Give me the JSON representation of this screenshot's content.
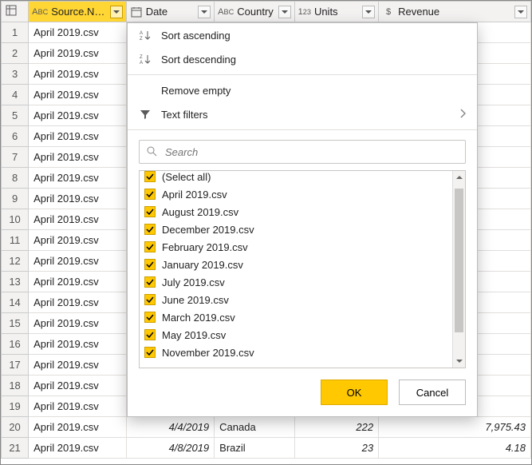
{
  "columns": [
    {
      "key": "source",
      "label": "Source.Name",
      "type_icon": "abc",
      "selected": true
    },
    {
      "key": "date",
      "label": "Date",
      "type_icon": "date"
    },
    {
      "key": "country",
      "label": "Country",
      "type_icon": "abc"
    },
    {
      "key": "units",
      "label": "Units",
      "type_icon": "123"
    },
    {
      "key": "revenue",
      "label": "Revenue",
      "type_icon": "dollar"
    }
  ],
  "rows": [
    {
      "n": 1,
      "source": "April 2019.csv"
    },
    {
      "n": 2,
      "source": "April 2019.csv"
    },
    {
      "n": 3,
      "source": "April 2019.csv"
    },
    {
      "n": 4,
      "source": "April 2019.csv"
    },
    {
      "n": 5,
      "source": "April 2019.csv"
    },
    {
      "n": 6,
      "source": "April 2019.csv"
    },
    {
      "n": 7,
      "source": "April 2019.csv"
    },
    {
      "n": 8,
      "source": "April 2019.csv"
    },
    {
      "n": 9,
      "source": "April 2019.csv"
    },
    {
      "n": 10,
      "source": "April 2019.csv"
    },
    {
      "n": 11,
      "source": "April 2019.csv"
    },
    {
      "n": 12,
      "source": "April 2019.csv"
    },
    {
      "n": 13,
      "source": "April 2019.csv"
    },
    {
      "n": 14,
      "source": "April 2019.csv"
    },
    {
      "n": 15,
      "source": "April 2019.csv"
    },
    {
      "n": 16,
      "source": "April 2019.csv"
    },
    {
      "n": 17,
      "source": "April 2019.csv"
    },
    {
      "n": 18,
      "source": "April 2019.csv"
    },
    {
      "n": 19,
      "source": "April 2019.csv"
    },
    {
      "n": 20,
      "source": "April 2019.csv",
      "date": "4/4/2019",
      "country": "Canada",
      "units": "222",
      "revenue": "7,975.43"
    },
    {
      "n": 21,
      "source": "April 2019.csv",
      "date": "4/8/2019",
      "country": "Brazil",
      "units": "23",
      "revenue": "4.18"
    }
  ],
  "menu": {
    "sort_asc": "Sort ascending",
    "sort_desc": "Sort descending",
    "remove_empty": "Remove empty",
    "text_filters": "Text filters"
  },
  "search": {
    "placeholder": "Search"
  },
  "filter_values": [
    "(Select all)",
    "April 2019.csv",
    "August 2019.csv",
    "December 2019.csv",
    "February 2019.csv",
    "January 2019.csv",
    "July 2019.csv",
    "June 2019.csv",
    "March 2019.csv",
    "May 2019.csv",
    "November 2019.csv"
  ],
  "buttons": {
    "ok": "OK",
    "cancel": "Cancel"
  }
}
